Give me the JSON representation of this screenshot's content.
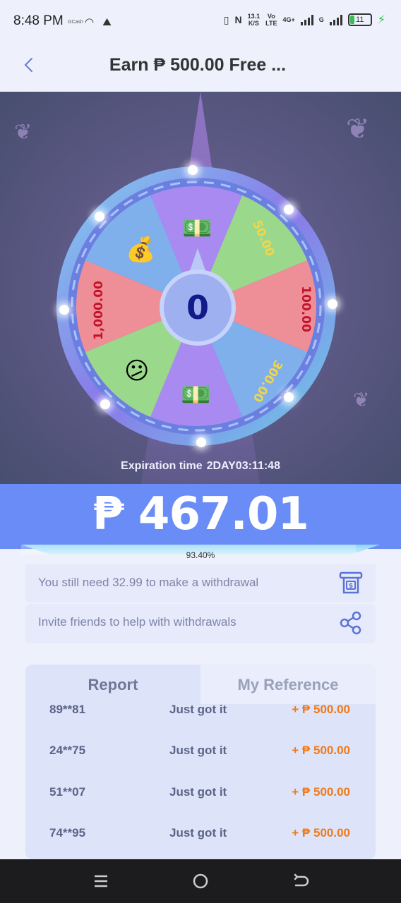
{
  "status_bar": {
    "time": "8:48 PM",
    "carrier_tag": "GCash",
    "speed_value": "13.1",
    "speed_unit": "K/S",
    "volte_top": "Vo",
    "volte_bottom": "LTE",
    "network": "4G+",
    "network2": "G",
    "battery": "11"
  },
  "header": {
    "title": "Earn ₱ 500.00 Free ..."
  },
  "wheel": {
    "center_value": "0",
    "segments": [
      "50.00",
      "100.00",
      "300.00",
      "1,000.00"
    ],
    "icons": [
      "cash-icon",
      "coins-icon",
      "sad-face-icon",
      "cash-icon"
    ]
  },
  "expiry": {
    "label": "Expiration time",
    "value": "2DAY03:11:48"
  },
  "balance": {
    "amount": "₱ 467.01",
    "progress_percent": 93.4,
    "progress_label": "93.40%"
  },
  "info": {
    "need_text": "You still need 32.99 to make a withdrawal",
    "invite_text": "Invite friends to help with withdrawals"
  },
  "report": {
    "tabs": [
      "Report",
      "My Reference"
    ],
    "rows": [
      {
        "phone": "89**81",
        "status": "Just got it",
        "amount": "+ ₱ 500.00"
      },
      {
        "phone": "24**75",
        "status": "Just got it",
        "amount": "+ ₱ 500.00"
      },
      {
        "phone": "51**07",
        "status": "Just got it",
        "amount": "+ ₱ 500.00"
      },
      {
        "phone": "74**95",
        "status": "Just got it",
        "amount": "+ ₱ 500.00"
      }
    ]
  },
  "colors": {
    "accent": "#6a8cf6",
    "amount_orange": "#f07a1a",
    "wheel_red": "#ee8e97",
    "wheel_green": "#9ad98b",
    "wheel_blue": "#7fb0ec",
    "wheel_purple": "#a98af0"
  }
}
